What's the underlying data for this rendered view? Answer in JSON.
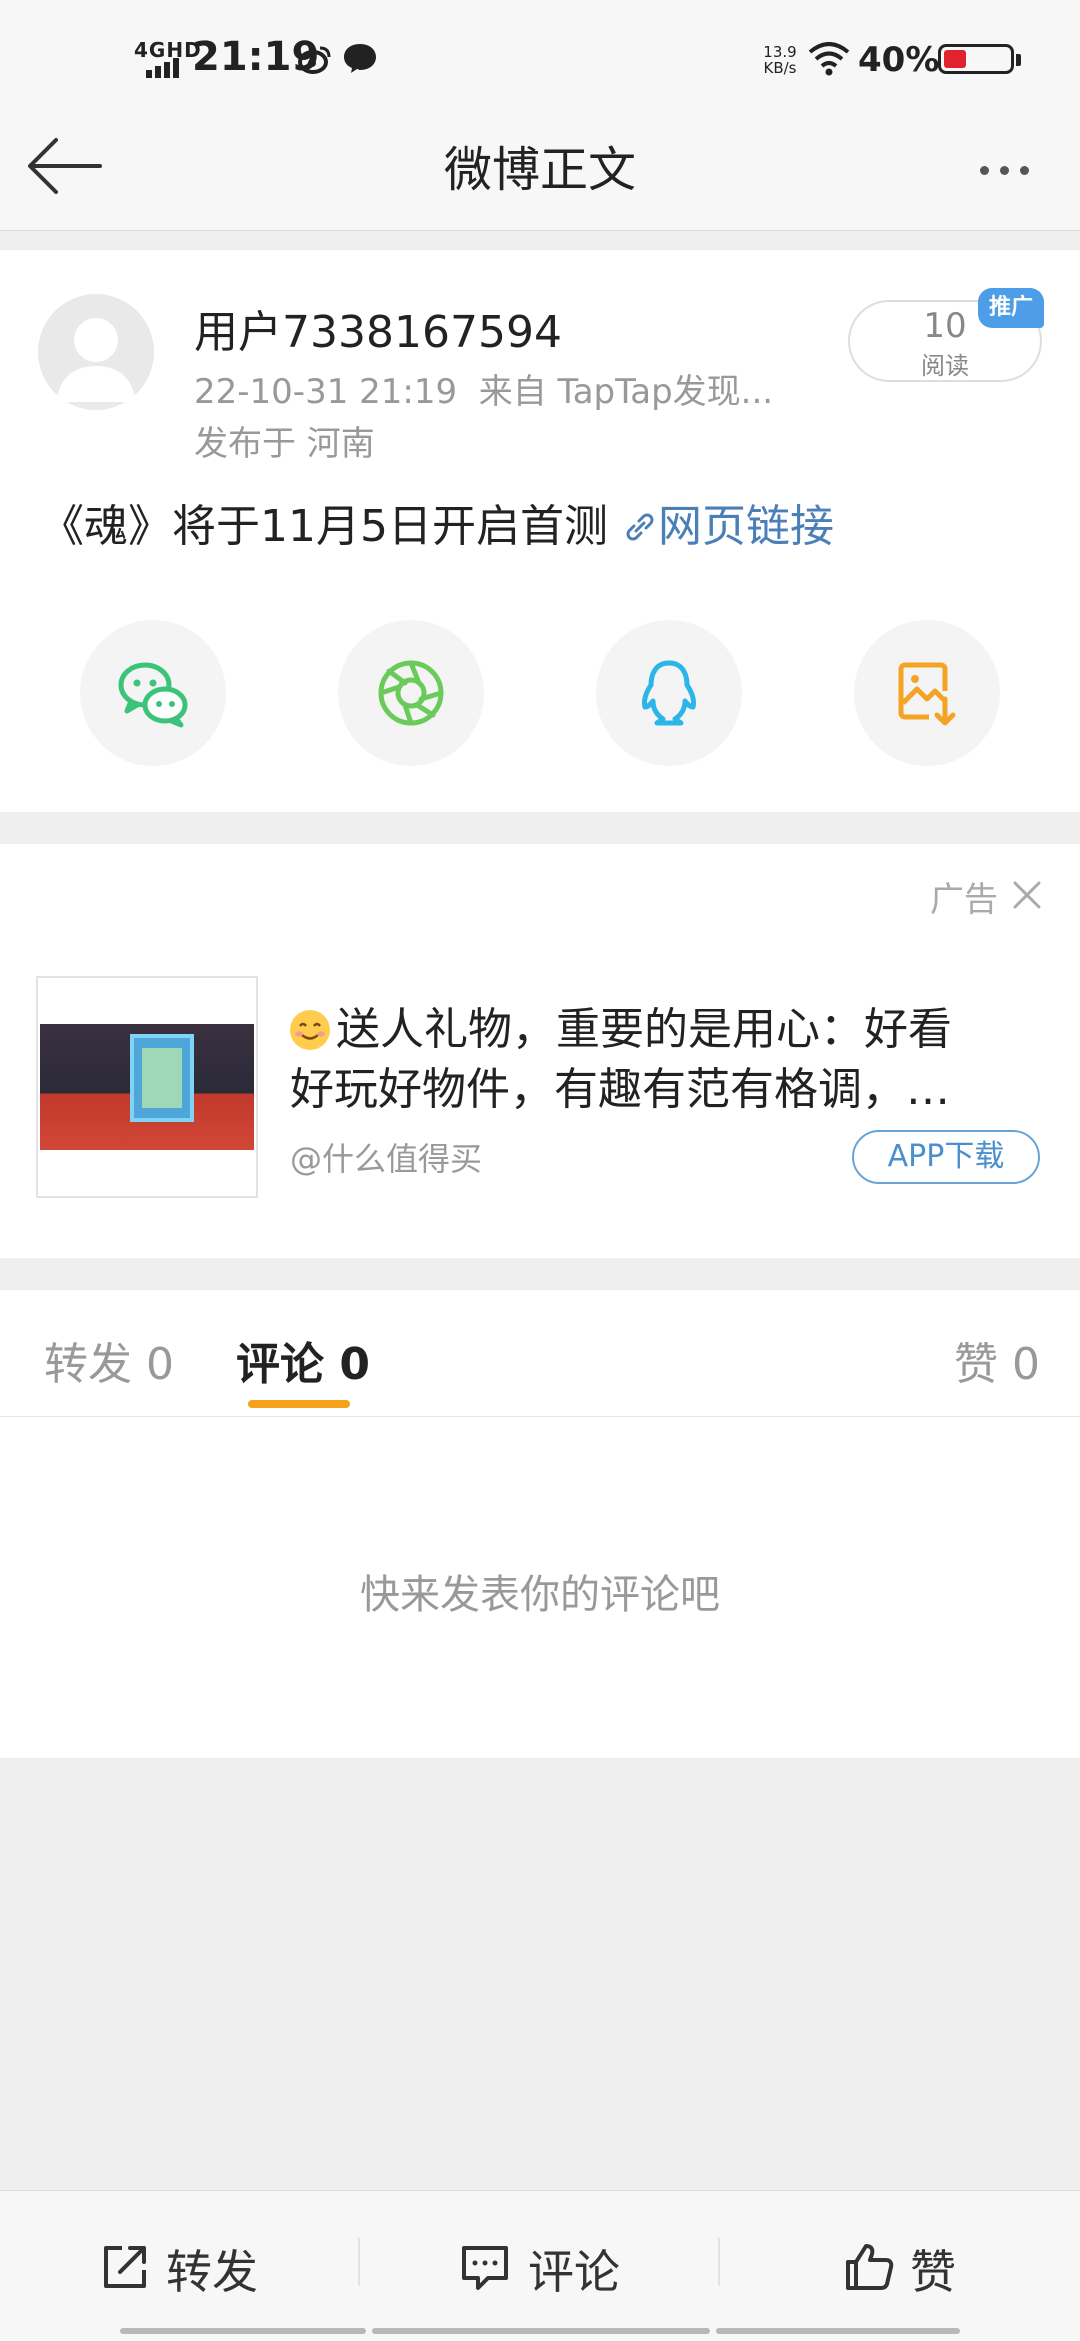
{
  "status_bar": {
    "network": "4GHD",
    "time": "21:19",
    "speed_value": "13.9",
    "speed_unit": "KB/s",
    "battery": "40%"
  },
  "nav": {
    "title": "微博正文"
  },
  "post": {
    "username": "用户7338167594",
    "timestamp": "22-10-31 21:19",
    "source": "来自 TapTap发现...",
    "location": "发布于 河南",
    "read_count": "10",
    "read_label": "阅读",
    "promo_badge": "推广",
    "text": "《魂》将于11月5日开启首测 ",
    "link_text": "网页链接",
    "share_icons": [
      "wechat-icon",
      "moments-icon",
      "qq-icon",
      "save-image-icon"
    ]
  },
  "ad": {
    "tag": "广告",
    "title_line1": "送人礼物，重要的是用心：好看",
    "title_line2": "好玩好物件，有趣有范有格调，…",
    "source": "@什么值得买",
    "button": "APP下载"
  },
  "tabs": {
    "repost": "转发 0",
    "comment": "评论 0",
    "like": "赞 0"
  },
  "empty_state": "快来发表你的评论吧",
  "bottom_bar": {
    "repost": "转发",
    "comment": "评论",
    "like": "赞"
  },
  "colors": {
    "accent": "#f7a21b",
    "link": "#4b7fb8",
    "promo": "#4d9de8",
    "background": "#efefef"
  }
}
